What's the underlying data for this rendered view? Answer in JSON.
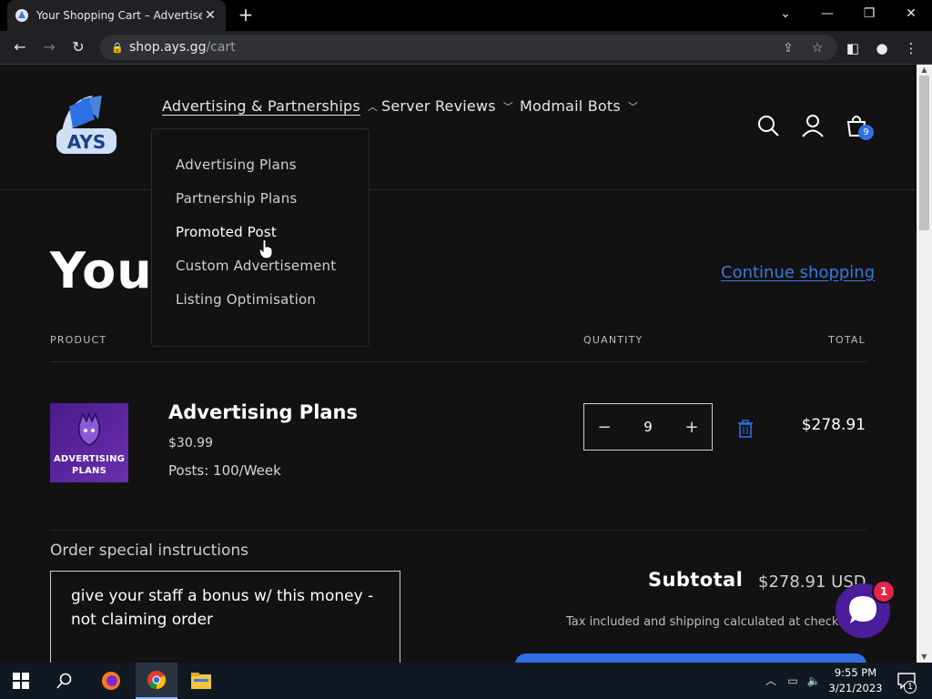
{
  "browser": {
    "tab_title": "Your Shopping Cart – Advertise Y",
    "tab_close": "✕",
    "new_tab": "+",
    "window_min": "—",
    "window_restore": "❐",
    "window_close": "✕",
    "url_host": "shop.ays.gg",
    "url_path": "/cart"
  },
  "header": {
    "logo_text": "AYS",
    "nav": [
      {
        "label": "Advertising & Partnerships",
        "active": true
      },
      {
        "label": "Server Reviews"
      },
      {
        "label": "Modmail Bots"
      }
    ],
    "cart_count": "9"
  },
  "dropdown": {
    "items": [
      "Advertising Plans",
      "Partnership Plans",
      "Promoted Post",
      "Custom Advertisement",
      "Listing Optimisation"
    ],
    "hovered_index": 2
  },
  "cart": {
    "title": "Your",
    "continue_label": "Continue shopping",
    "col_product": "PRODUCT",
    "col_quantity": "QUANTITY",
    "col_total": "TOTAL",
    "item": {
      "image_line1": "ADVERTISING",
      "image_line2": "PLANS",
      "name": "Advertising Plans",
      "price": "$30.99",
      "option": "Posts: 100/Week",
      "quantity": "9",
      "minus": "−",
      "plus": "+",
      "total": "$278.91"
    },
    "instructions_label": "Order special instructions",
    "instructions_value": "give your staff a bonus w/ this money - not claiming order",
    "subtotal_label": "Subtotal",
    "subtotal_value": "$278.91 USD",
    "tax_note": "Tax included and shipping calculated at checkout"
  },
  "chat": {
    "badge": "1"
  },
  "taskbar": {
    "time": "9:55 PM",
    "date": "3/21/2023",
    "notif_count": "1"
  },
  "colors": {
    "accent": "#2f6fe4",
    "page_bg": "#121212",
    "chat_bg": "#4b1d9a",
    "badge_red": "#e4264b"
  }
}
